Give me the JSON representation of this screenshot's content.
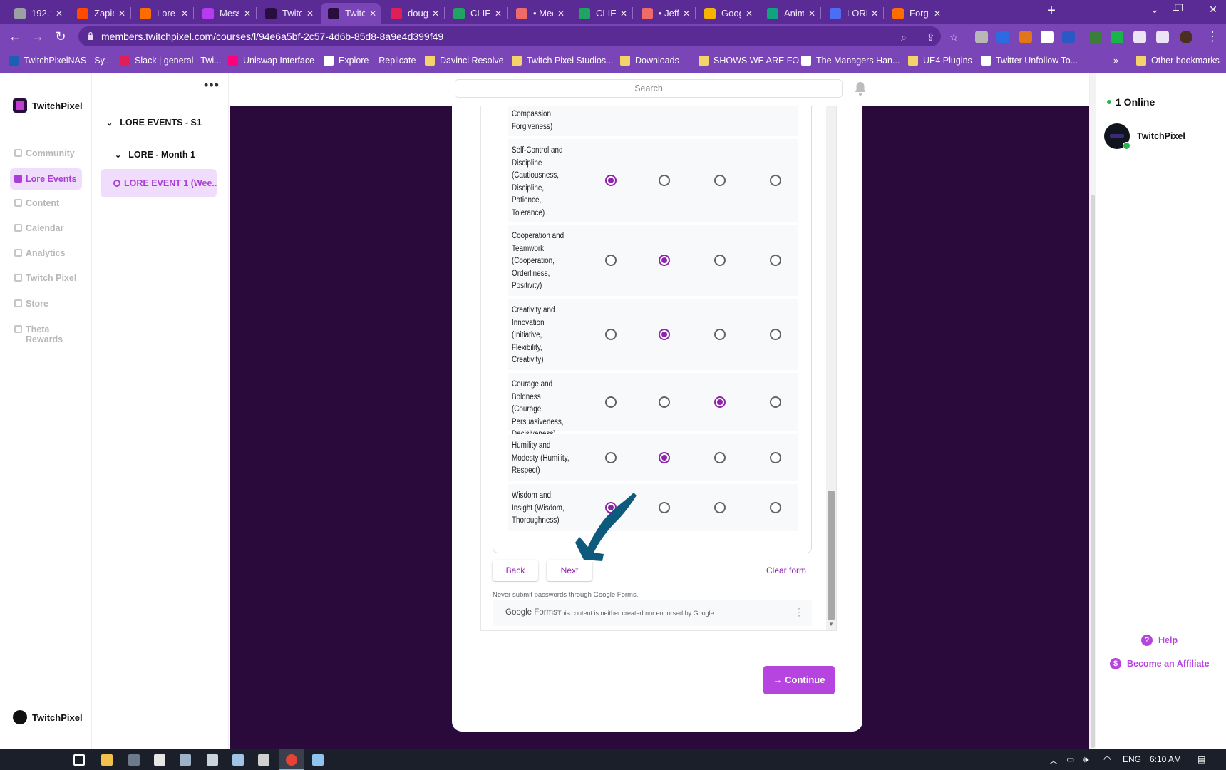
{
  "browser": {
    "tabs": [
      {
        "label": "192.1(",
        "color": "#9aa0a6",
        "active": false
      },
      {
        "label": "Zapier",
        "color": "#ff4a00",
        "active": false
      },
      {
        "label": "Lore E",
        "color": "#ff6d00",
        "active": false
      },
      {
        "label": "Messe",
        "color": "#b83bf0",
        "active": false
      },
      {
        "label": "Twitch",
        "color": "#2a0d3f",
        "active": false
      },
      {
        "label": "Twitch",
        "color": "#2a0d3f",
        "active": true
      },
      {
        "label": "doug",
        "color": "#e01e5a",
        "active": false
      },
      {
        "label": "CLIEN",
        "color": "#1fa463",
        "active": false
      },
      {
        "label": "• Mee",
        "color": "#f06a6a",
        "active": false
      },
      {
        "label": "CLIEN",
        "color": "#1fa463",
        "active": false
      },
      {
        "label": "• Jeff",
        "color": "#f06a6a",
        "active": false
      },
      {
        "label": "Googl",
        "color": "#f6b400",
        "active": false
      },
      {
        "label": "Anima",
        "color": "#10a37f",
        "active": false
      },
      {
        "label": "LORE",
        "color": "#4a6ef5",
        "active": false
      },
      {
        "label": "Forgo",
        "color": "#ff6d00",
        "active": false
      }
    ],
    "url": "members.twitchpixel.com/courses/l/94e6a5bf-2c57-4d6b-85d8-8a9e4d399f49",
    "bookmarks": [
      {
        "label": "TwitchPixelNAS - Sy...",
        "type": "site",
        "color": "#1c5fb5"
      },
      {
        "label": "Slack | general | Twi...",
        "type": "site",
        "color": "#e01e5a"
      },
      {
        "label": "Uniswap Interface",
        "type": "site",
        "color": "#ff007a"
      },
      {
        "label": "Explore – Replicate",
        "type": "site",
        "color": "#ffffff"
      },
      {
        "label": "Davinci Resolve",
        "type": "folder",
        "color": "#f5d36b"
      },
      {
        "label": "Twitch Pixel Studios...",
        "type": "folder",
        "color": "#f5d36b"
      },
      {
        "label": "Downloads",
        "type": "folder",
        "color": "#f5d36b"
      },
      {
        "label": "SHOWS WE ARE FO...",
        "type": "folder",
        "color": "#f5d36b"
      },
      {
        "label": "The Managers Han...",
        "type": "site",
        "color": "#ffffff"
      },
      {
        "label": "UE4 Plugins",
        "type": "folder",
        "color": "#f5d36b"
      },
      {
        "label": "Twitter Unfollow To...",
        "type": "site",
        "color": "#ffffff"
      }
    ],
    "bookmarks_overflow": "»",
    "other_bookmarks": "Other bookmarks"
  },
  "sidebar": {
    "brand": "TwitchPixel",
    "items": [
      {
        "label": "Community",
        "active": false
      },
      {
        "label": "Lore Events",
        "active": true
      },
      {
        "label": "Content",
        "active": false
      },
      {
        "label": "Calendar",
        "active": false
      },
      {
        "label": "Analytics",
        "active": false
      },
      {
        "label": "Twitch Pixel",
        "active": false
      },
      {
        "label": "Store",
        "active": false
      },
      {
        "label": "Theta Rewards",
        "active": false
      }
    ],
    "footer_user": "TwitchPixel"
  },
  "course_tree": {
    "menu": "•••",
    "section": "LORE EVENTS - S1",
    "module": "LORE - Month 1",
    "lesson": "LORE EVENT 1 (Wee..."
  },
  "header": {
    "search_placeholder": "Search"
  },
  "form": {
    "partial_label": "Compassion, Forgiveness)",
    "rows": [
      {
        "label": "Self-Control and Discipline (Cautiousness, Discipline, Patience, Tolerance)",
        "selected": 0
      },
      {
        "label": "Cooperation and Teamwork (Cooperation, Orderliness, Positivity)",
        "selected": 1
      },
      {
        "label": "Creativity and Innovation (Initiative, Flexibility, Creativity)",
        "selected": 1
      },
      {
        "label": "Courage and Boldness (Courage, Persuasiveness, Decisiveness)",
        "selected": 2
      },
      {
        "label": "Humility and Modesty (Humility, Respect)",
        "selected": 1
      },
      {
        "label": "Wisdom and Insight (Wisdom, Thoroughness)",
        "selected": 0
      }
    ],
    "back_label": "Back",
    "next_label": "Next",
    "clear_label": "Clear form",
    "never_submit": "Never submit passwords through Google Forms.",
    "google_label": "Google",
    "forms_label": "Forms",
    "disclaimer": "This content is neither created nor endorsed by Google."
  },
  "continue_label": "Continue",
  "right_panel": {
    "online": "1 Online",
    "member": "TwitchPixel",
    "help": "Help",
    "affiliate": "Become an Affiliate"
  },
  "taskbar": {
    "lang": "ENG",
    "time": "6:10 AM"
  },
  "colors": {
    "brand_purple": "#b645e0",
    "stage_bg": "#290a3b",
    "chrome_purple": "#7a45b6",
    "form_accent": "#8e24aa",
    "annotation_arrow": "#0d5a7d"
  }
}
